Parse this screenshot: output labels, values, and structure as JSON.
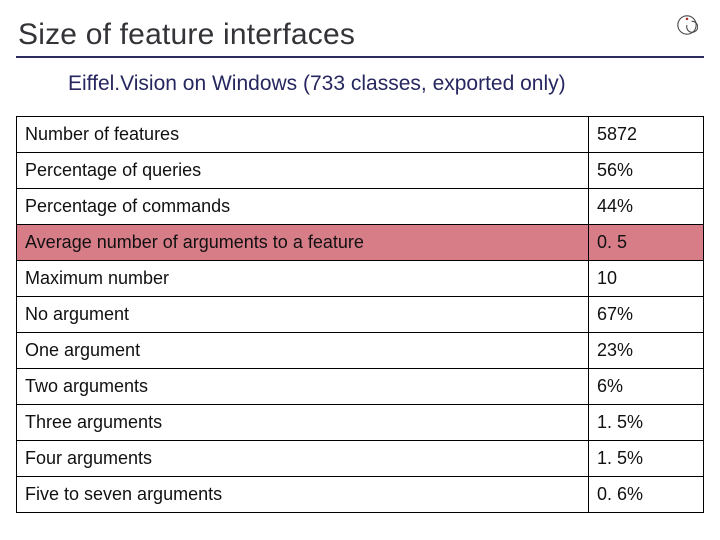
{
  "title": "Size of feature interfaces",
  "subtitle": "Eiffel.Vision on Windows (733 classes, exported only)",
  "chart_data": {
    "type": "table",
    "title": "Size of feature interfaces — Eiffel.Vision on Windows (733 classes, exported only)",
    "rows": [
      {
        "label": "Number of features",
        "value": "5872"
      },
      {
        "label": "Percentage of queries",
        "value": "56%"
      },
      {
        "label": "Percentage of commands",
        "value": "44%"
      },
      {
        "label": "Average number of arguments to a feature",
        "value": "0. 5",
        "highlight": true
      },
      {
        "label": "Maximum number",
        "value": "10"
      },
      {
        "label": "No argument",
        "value": "67%"
      },
      {
        "label": "One argument",
        "value": "23%"
      },
      {
        "label": "Two arguments",
        "value": "6%"
      },
      {
        "label": "Three arguments",
        "value": "1. 5%"
      },
      {
        "label": "Four arguments",
        "value": "1. 5%"
      },
      {
        "label": "Five to seven arguments",
        "value": "0. 6%"
      }
    ]
  }
}
